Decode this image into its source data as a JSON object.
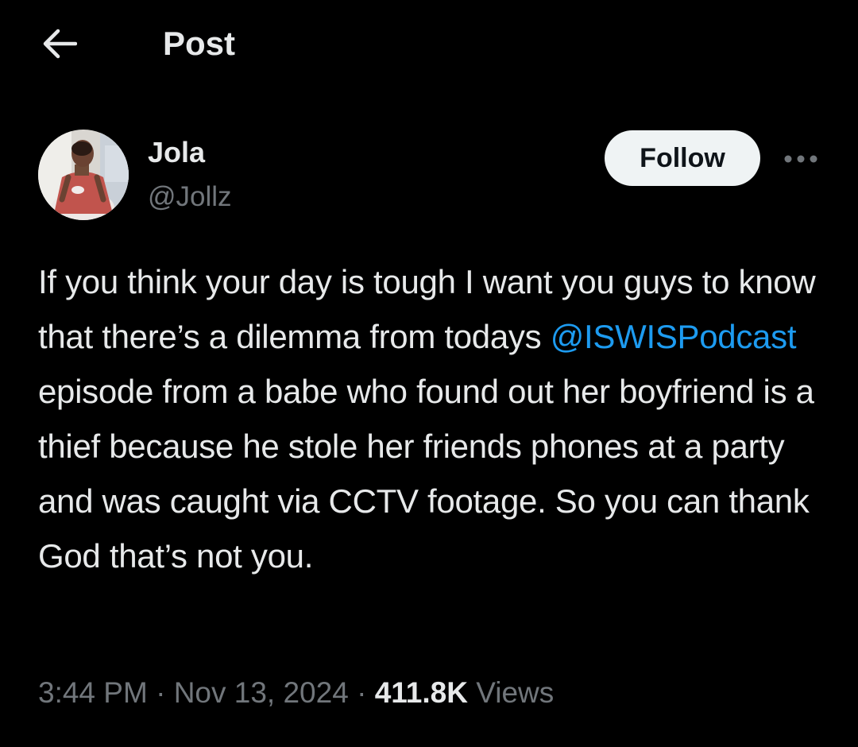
{
  "header": {
    "title": "Post",
    "back_icon": "arrow-left-icon"
  },
  "author": {
    "name": "Jola",
    "handle": "@Jollz",
    "avatar_icon": "profile-photo"
  },
  "actions": {
    "follow_label": "Follow",
    "more_icon": "more-horizontal-icon"
  },
  "post": {
    "text_part1": "If you think your day is tough I want you guys to know that there’s a dilemma from todays ",
    "mention": "@ISWISPodcast",
    "text_part2": " episode from a babe who found out her boyfriend is a thief because he stole her friends phones at a party and was caught via CCTV footage. So you can thank God that’s not you."
  },
  "meta": {
    "time": "3:44 PM",
    "separator": " · ",
    "date": "Nov 13, 2024",
    "views_count": "411.8K",
    "views_label": " Views"
  },
  "colors": {
    "background": "#000000",
    "text": "#e7e9ea",
    "secondary": "#71767b",
    "link": "#1d9bf0",
    "follow_bg": "#eff3f4"
  }
}
